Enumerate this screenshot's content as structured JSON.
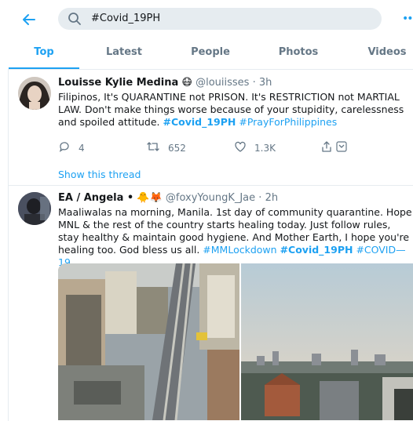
{
  "search": {
    "query": "#Covid_19PH"
  },
  "tabs": [
    {
      "label": "Top",
      "active": true
    },
    {
      "label": "Latest"
    },
    {
      "label": "People"
    },
    {
      "label": "Photos"
    },
    {
      "label": "Videos"
    }
  ],
  "tweets": [
    {
      "name": "Louisse Kylie Medina",
      "emoji": "😷",
      "handle": "@louiisses",
      "time": "3h",
      "text_plain": "Filipinos, It's QUARANTINE not PRISON. It's RESTRICTION not MARTIAL LAW. Don't make things worse because of your stupidity, carelessness and spoiled attitude.",
      "hashtag_bold": "#Covid_19PH",
      "hashtag_2": "#PrayForPhilippines",
      "replies": "4",
      "retweets": "652",
      "likes": "1.3K",
      "show_thread": "Show this thread"
    },
    {
      "name": "EA / Angela •",
      "emoji": "🐥🦊",
      "handle": "@foxyYoungK_Jae",
      "time": "2h",
      "text_plain": "Maaliwalas na morning, Manila. 1st day of community quarantine. Hope MNL & the rest of the country starts healing today. Just follow rules, stay healthy & maintain good hygiene. And Mother Earth, I hope you're healing too. God bless us all.",
      "hashtag_1": "#MMLockdown",
      "hashtag_bold": "#Covid_19PH",
      "hashtag_3": "#COVID—19"
    }
  ],
  "colors": {
    "accent": "#1da1f2",
    "muted": "#657786",
    "divider": "#e6ecf0"
  }
}
